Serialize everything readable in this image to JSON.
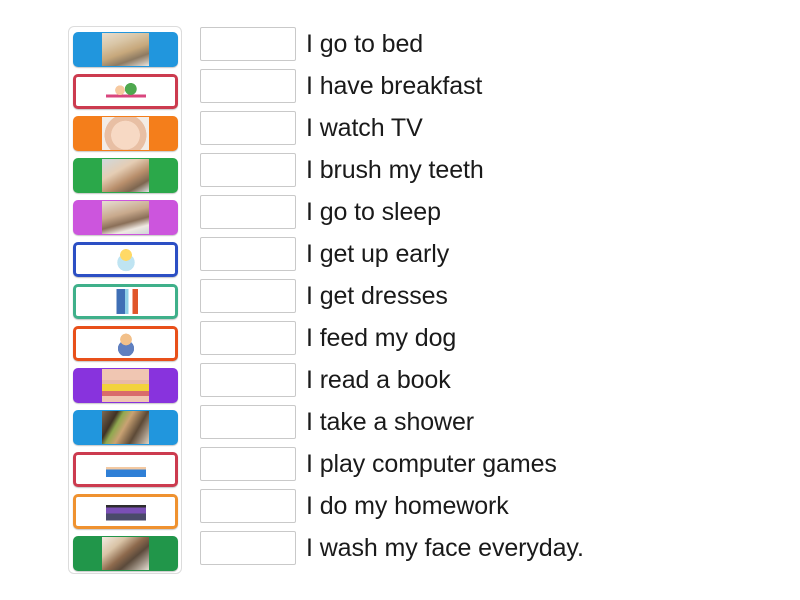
{
  "activity": {
    "type": "match-up",
    "tile_count": 13,
    "row_count": 13
  },
  "tiles": [
    {
      "id": "tile-1",
      "style": "filled",
      "color": "#2196dd",
      "border_color": "#2196dd",
      "image": "child-sleeping-in-bed-photo",
      "alt": "child asleep in bed"
    },
    {
      "id": "tile-2",
      "style": "outline",
      "color": "#ffffff",
      "border_color": "#cc3b4f",
      "image": "cartoon-breakfast-table",
      "alt": "cartoon child having breakfast"
    },
    {
      "id": "tile-3",
      "style": "filled",
      "color": "#f47e1b",
      "border_color": "#f47e1b",
      "image": "baby-face-photo",
      "alt": "sleeping baby face"
    },
    {
      "id": "tile-4",
      "style": "filled",
      "color": "#2ba84a",
      "border_color": "#2ba84a",
      "image": "child-washing-hair-photo",
      "alt": "child washing"
    },
    {
      "id": "tile-5",
      "style": "filled",
      "color": "#cc55dd",
      "border_color": "#cc55dd",
      "image": "child-at-desk-photo",
      "alt": "tired child at desk"
    },
    {
      "id": "tile-6",
      "style": "outline",
      "color": "#ffffff",
      "border_color": "#2c4fc4",
      "image": "cartoon-child-in-bathtub",
      "alt": "cartoon child in bathtub"
    },
    {
      "id": "tile-7",
      "style": "outline",
      "color": "#ffffff",
      "border_color": "#3fb08a",
      "image": "cartoon-child-at-computer",
      "alt": "cartoon child at computer"
    },
    {
      "id": "tile-8",
      "style": "outline",
      "color": "#ffffff",
      "border_color": "#e8501a",
      "image": "cartoon-child-playing",
      "alt": "cartoon child sitting with toys"
    },
    {
      "id": "tile-9",
      "style": "filled",
      "color": "#8833dd",
      "border_color": "#8833dd",
      "image": "mouth-with-corn-photo",
      "alt": "smiling mouth eating corn"
    },
    {
      "id": "tile-10",
      "style": "filled",
      "color": "#2196dd",
      "border_color": "#2196dd",
      "image": "child-watching-tv-photo",
      "alt": "child watching television"
    },
    {
      "id": "tile-11",
      "style": "outline",
      "color": "#ffffff",
      "border_color": "#cc3b4f",
      "image": "cartoon-child-jumping-on-bed",
      "alt": "cartoon child on blue bed"
    },
    {
      "id": "tile-12",
      "style": "outline",
      "color": "#ffffff",
      "border_color": "#ef9230",
      "image": "cartoon-child-standing",
      "alt": "cartoon child standing"
    },
    {
      "id": "tile-13",
      "style": "filled",
      "color": "#21964a",
      "border_color": "#21964a",
      "image": "child-reading-book-photo",
      "alt": "child reading a book"
    }
  ],
  "rows": [
    {
      "answer": "",
      "placeholder": "",
      "label": "I go to bed"
    },
    {
      "answer": "",
      "placeholder": "",
      "label": "I have breakfast"
    },
    {
      "answer": "",
      "placeholder": "",
      "label": "I watch TV"
    },
    {
      "answer": "",
      "placeholder": "",
      "label": "I brush my teeth"
    },
    {
      "answer": "",
      "placeholder": "",
      "label": "I go to sleep"
    },
    {
      "answer": "",
      "placeholder": "",
      "label": "I get up early"
    },
    {
      "answer": "",
      "placeholder": "",
      "label": "I get dresses"
    },
    {
      "answer": "",
      "placeholder": "",
      "label": "I feed my dog"
    },
    {
      "answer": "",
      "placeholder": "",
      "label": "I read a book"
    },
    {
      "answer": "",
      "placeholder": "",
      "label": "I take a shower"
    },
    {
      "answer": "",
      "placeholder": "",
      "label": "I play computer games"
    },
    {
      "answer": "",
      "placeholder": "",
      "label": "I do my homework"
    },
    {
      "answer": "",
      "placeholder": "",
      "label": "I wash my face everyday."
    }
  ],
  "colors": {
    "page_background": "#ffffff",
    "panel_border": "#dcdcdc",
    "dropzone_border": "#c9c9c9",
    "label_text": "#1a1a1a"
  }
}
